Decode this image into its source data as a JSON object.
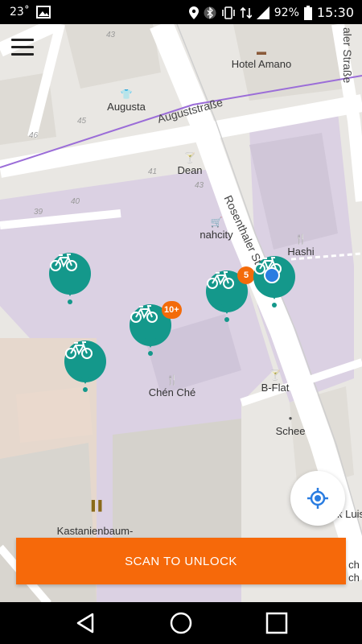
{
  "status_bar": {
    "temperature": "23˚",
    "battery": "92%",
    "time": "15:30"
  },
  "map": {
    "streets": [
      "Auguststraße",
      "Rosenthaler Straße",
      "aler Straße"
    ],
    "pois": [
      {
        "name": "Hotel Amano",
        "icon": "hotel-icon"
      },
      {
        "name": "Augusta",
        "icon": "shirt-icon"
      },
      {
        "name": "Dean",
        "icon": "cocktail-icon"
      },
      {
        "name": "nahcity",
        "icon": "shopping-cart-icon"
      },
      {
        "name": "Hashi",
        "icon": "restaurant-icon"
      },
      {
        "name": "Chén Ché",
        "icon": "restaurant-icon"
      },
      {
        "name": "B-Flat",
        "icon": "cocktail-icon"
      },
      {
        "name": "Schee",
        "icon": "dot-icon"
      },
      {
        "name": "Kastanienbaum-\nGrundschule",
        "icon": "school-icon"
      }
    ],
    "house_numbers": [
      "43",
      "45",
      "46",
      "41",
      "43",
      "39",
      "40"
    ],
    "edge_fragments": [
      "k Luis",
      "ch",
      "ch"
    ]
  },
  "bikes": [
    {
      "id": "bike-1",
      "badge": ""
    },
    {
      "id": "bike-2",
      "badge": "10+"
    },
    {
      "id": "bike-3",
      "badge": ""
    },
    {
      "id": "bike-4",
      "badge": "5"
    },
    {
      "id": "bike-5",
      "badge": ""
    }
  ],
  "actions": {
    "scan_label": "SCAN TO UNLOCK"
  },
  "colors": {
    "bike_pin": "#14988b",
    "badge": "#f36b0a",
    "scan_button": "#f6690a",
    "location_accent": "#2a7de1",
    "bike_lane": "#9b6dd8",
    "building_zone": "#dcd2e4"
  }
}
